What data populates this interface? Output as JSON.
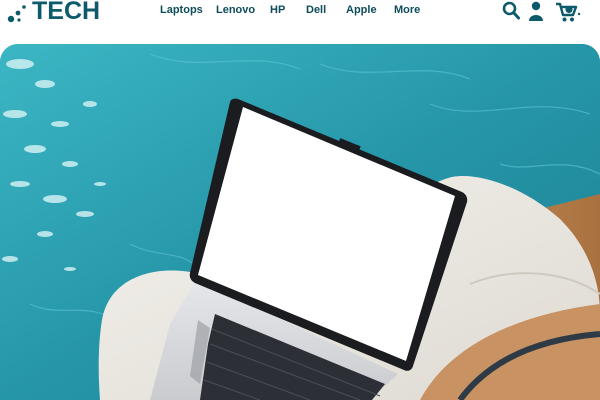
{
  "header": {
    "logo_text": "TECH",
    "nav": [
      {
        "label": "Laptops"
      },
      {
        "label": "Lenovo"
      },
      {
        "label": "HP"
      },
      {
        "label": "Dell"
      },
      {
        "label": "Apple"
      },
      {
        "label": "More"
      }
    ],
    "icons": [
      "search-icon",
      "user-icon",
      "cart-icon"
    ]
  },
  "hero": {
    "image": "laptop-on-lounger-by-pool"
  },
  "colors": {
    "brand": "#0d5a6b",
    "nav_text": "#0e4c5c",
    "pool": "#2a9fae"
  }
}
